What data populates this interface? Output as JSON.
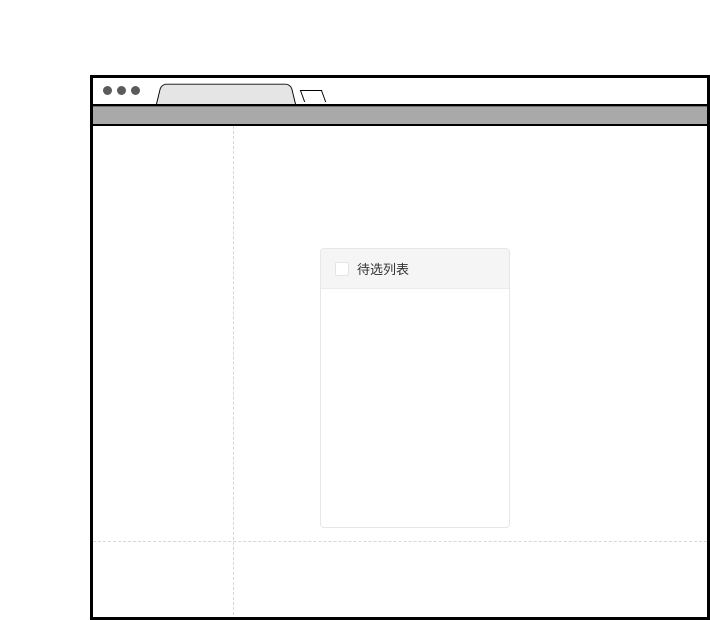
{
  "transfer": {
    "title": "待选列表"
  }
}
